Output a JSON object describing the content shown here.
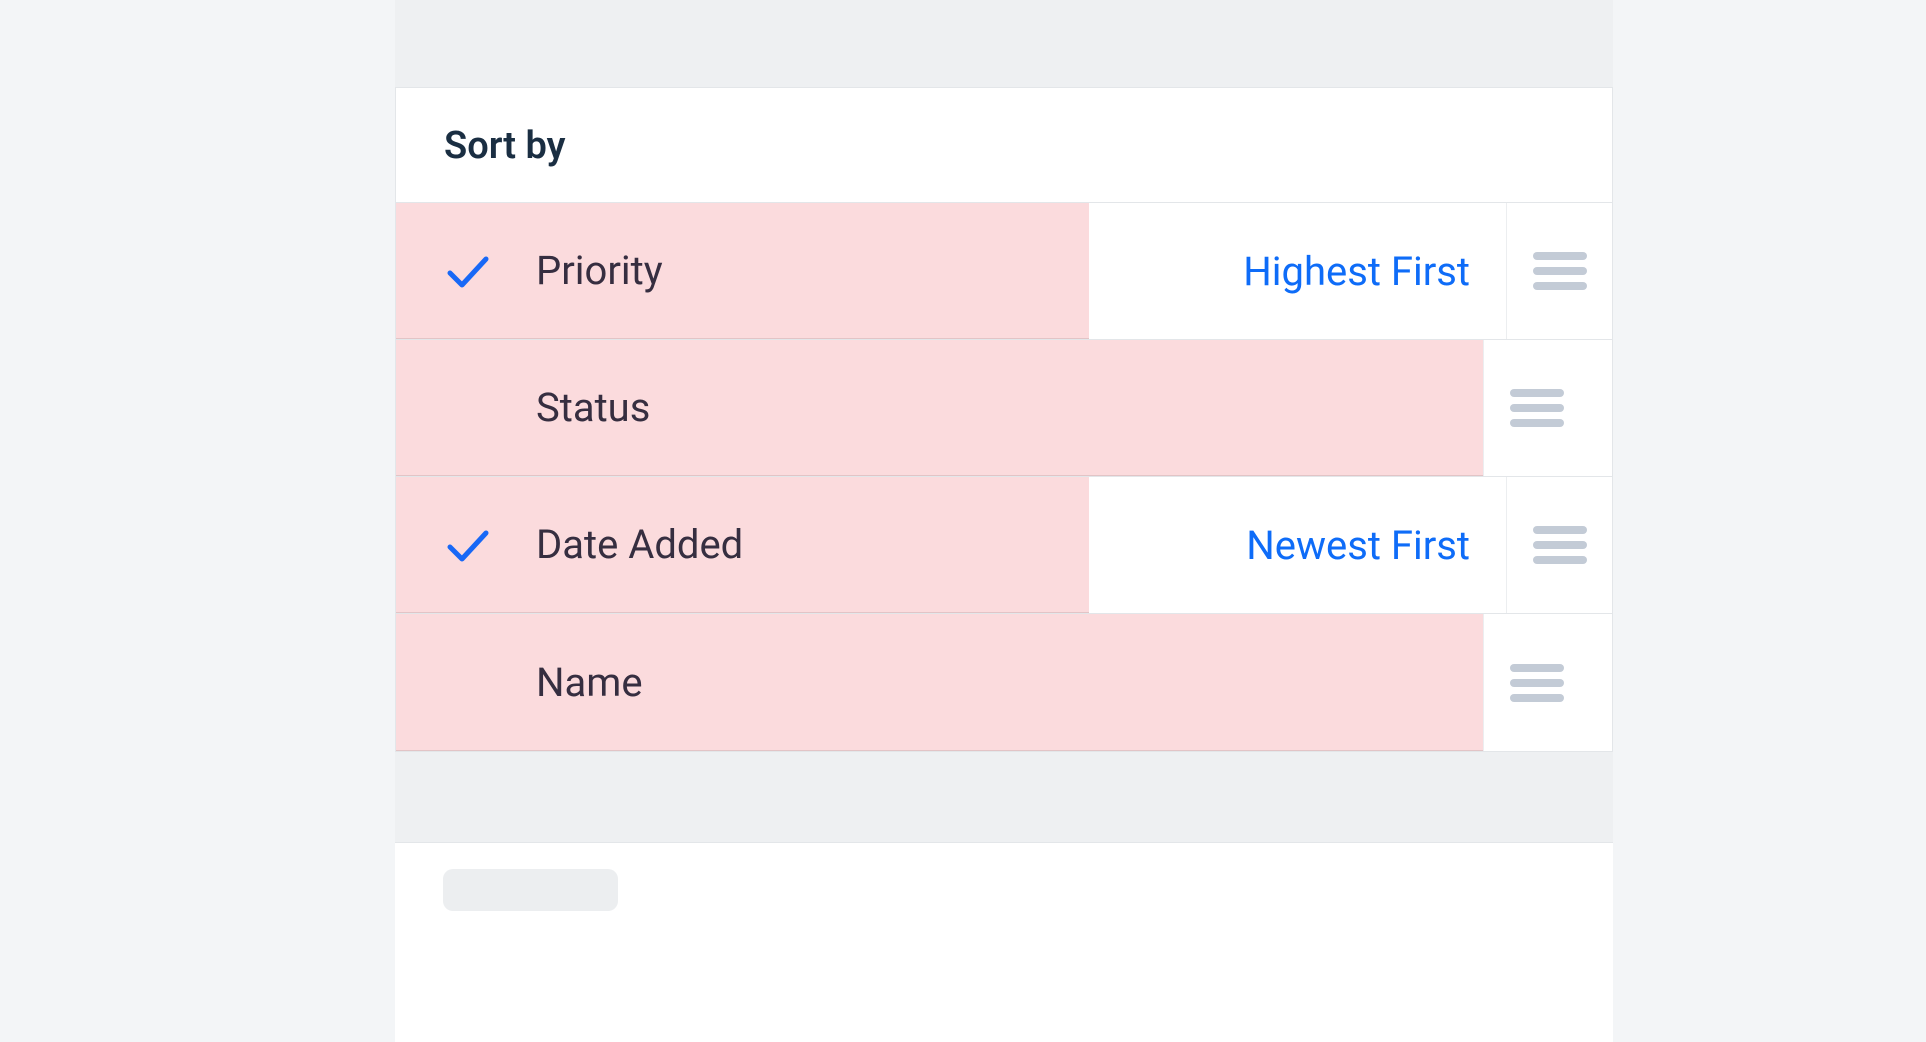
{
  "sort": {
    "header": "Sort by",
    "items": [
      {
        "label": "Priority",
        "checked": true,
        "order": "Highest First"
      },
      {
        "label": "Status",
        "checked": false,
        "order": ""
      },
      {
        "label": "Date Added",
        "checked": true,
        "order": "Newest First"
      },
      {
        "label": "Name",
        "checked": false,
        "order": ""
      }
    ]
  }
}
